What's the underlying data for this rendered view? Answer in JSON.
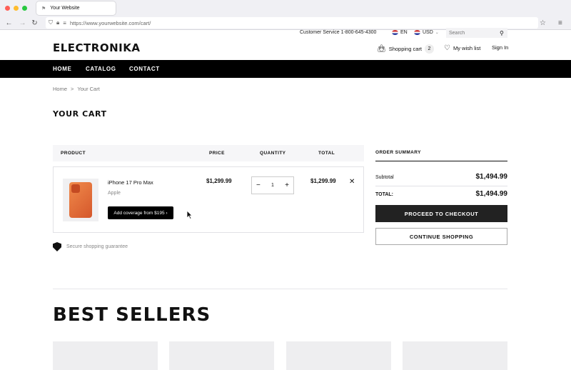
{
  "browser": {
    "tab_title": "Your Website",
    "url": "https://www.yourwebsite.com/cart/",
    "traffic_colors": [
      "#ff5f57",
      "#febc2e",
      "#28c840"
    ]
  },
  "utility": {
    "customer_service": "Customer Service 1-800-645-4300",
    "language": "EN",
    "currency": "USD",
    "search_placeholder": "Search"
  },
  "header": {
    "logo": "ELECTRONIKA",
    "cart_label": "Shopping cart",
    "cart_count": "2",
    "wishlist_label": "My wish list",
    "signin_label": "Sign In"
  },
  "nav": {
    "items": [
      "HOME",
      "CATALOG",
      "CONTACT"
    ]
  },
  "breadcrumb": {
    "home": "Home",
    "separator": ">",
    "current": "Your Cart"
  },
  "page": {
    "title": "YOUR CART"
  },
  "cart": {
    "headers": {
      "product": "PRODUCT",
      "price": "PRICE",
      "quantity": "QUANTITY",
      "total": "TOTAL"
    },
    "items": [
      {
        "name": "iPhone 17 Pro Max",
        "brand": "Apple",
        "coverage_label": "Add coverage from $195 ›",
        "price": "$1,299.99",
        "quantity": "1",
        "total": "$1,299.99"
      }
    ],
    "secure_text": "Secure shopping guarantee"
  },
  "summary": {
    "title": "ORDER SUMMARY",
    "subtotal_label": "Subtotal",
    "subtotal_value": "$1,494.99",
    "total_label": "TOTAL:",
    "total_value": "$1,494.99",
    "checkout_label": "PROCEED TO CHECKOUT",
    "continue_label": "CONTINUE SHOPPING"
  },
  "best_sellers": {
    "title": "BEST SELLERS"
  }
}
